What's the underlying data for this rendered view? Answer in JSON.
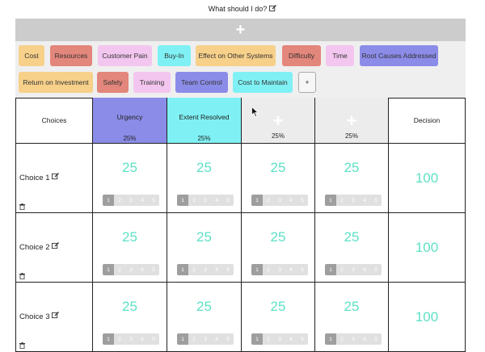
{
  "header": {
    "title": "What should I do?",
    "add_symbol": "+"
  },
  "tags": [
    {
      "label": "Cost",
      "color": "#f7d08a"
    },
    {
      "label": "Resources",
      "color": "#e3867b"
    },
    {
      "label": "Customer Pain",
      "color": "#f3c6ef"
    },
    {
      "label": "Buy-In",
      "color": "#7ff1f4"
    },
    {
      "label": "Effect on Other Systems",
      "color": "#f7d08a"
    },
    {
      "label": "Difficulty",
      "color": "#e3867b"
    },
    {
      "label": "Time",
      "color": "#f3c6ef"
    },
    {
      "label": "Root Causes Addressed",
      "color": "#8b8ce8"
    },
    {
      "label": "Return on Investment",
      "color": "#f7d08a"
    },
    {
      "label": "Safety",
      "color": "#e3867b"
    },
    {
      "label": "Training",
      "color": "#f3c6ef"
    },
    {
      "label": "Team Control",
      "color": "#8b8ce8"
    },
    {
      "label": "Cost to Maintain",
      "color": "#7ff1f4"
    },
    {
      "label": "+",
      "color": "#f6f6f6"
    }
  ],
  "grid": {
    "choices_header": "Choices",
    "decision_header": "Decision",
    "criteria": [
      {
        "label": "Urgency",
        "weight": "25%",
        "color": "#8b8ce8"
      },
      {
        "label": "Extent Resolved",
        "weight": "25%",
        "color": "#7ff1f4"
      },
      {
        "label": "+",
        "weight": "25%",
        "color": "#ececec"
      },
      {
        "label": "+",
        "weight": "25%",
        "color": "#ececec"
      }
    ],
    "rating_scale": [
      "1",
      "2",
      "3",
      "4",
      "5"
    ],
    "rows": [
      {
        "name": "Choice 1",
        "scores": [
          "25",
          "25",
          "25",
          "25"
        ],
        "ratings": [
          1,
          1,
          1,
          1
        ],
        "decision": "100"
      },
      {
        "name": "Choice 2",
        "scores": [
          "25",
          "25",
          "25",
          "25"
        ],
        "ratings": [
          1,
          1,
          1,
          1
        ],
        "decision": "100"
      },
      {
        "name": "Choice 3",
        "scores": [
          "25",
          "25",
          "25",
          "25"
        ],
        "ratings": [
          1,
          1,
          1,
          1
        ],
        "decision": "100"
      }
    ]
  },
  "icons": {
    "edit": "edit-icon",
    "trash": "trash-icon",
    "cursor": "mouse-pointer-icon"
  }
}
